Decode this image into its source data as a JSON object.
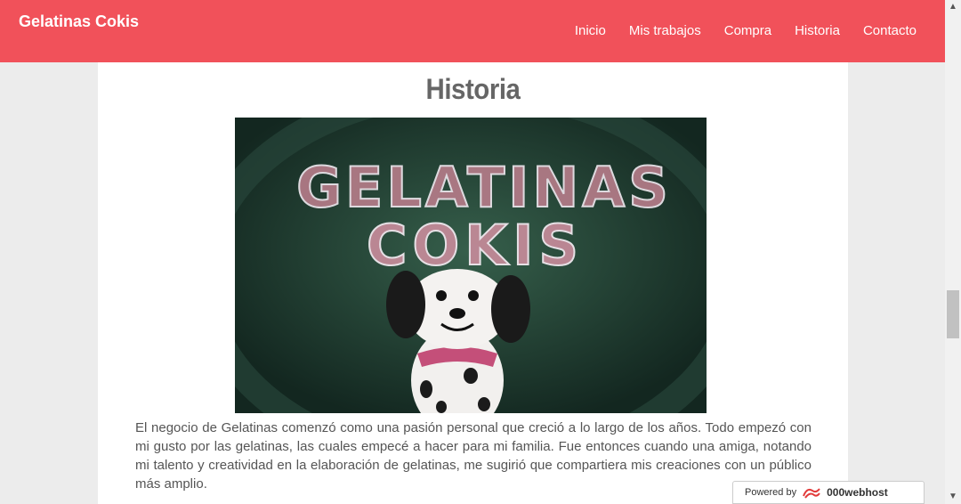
{
  "header": {
    "brand": "Gelatinas Cokis",
    "nav": [
      "Inicio",
      "Mis trabajos",
      "Compra",
      "Historia",
      "Contacto"
    ]
  },
  "main": {
    "title": "Historia",
    "image_text": [
      "GELATINAS",
      "COKIS"
    ],
    "paragraph": "El negocio de Gelatinas comenzó como una pasión personal que creció a lo largo de los años. Todo empezó con mi gusto por las gelatinas, las cuales empecé a hacer para mi familia. Fue entonces cuando una amiga, notando mi talento y creatividad en la elaboración de gelatinas, me sugirió que compartiera mis creaciones con un público más amplio."
  },
  "badge": {
    "powered_by": "Powered by",
    "host": "000webhost"
  },
  "colors": {
    "navbar": "#f1515a",
    "title": "#666666",
    "text": "#555555"
  },
  "icons": {
    "scroll_up": "chevron-up-icon",
    "scroll_down": "chevron-down-icon",
    "host_logo": "webhost-logo-icon"
  }
}
